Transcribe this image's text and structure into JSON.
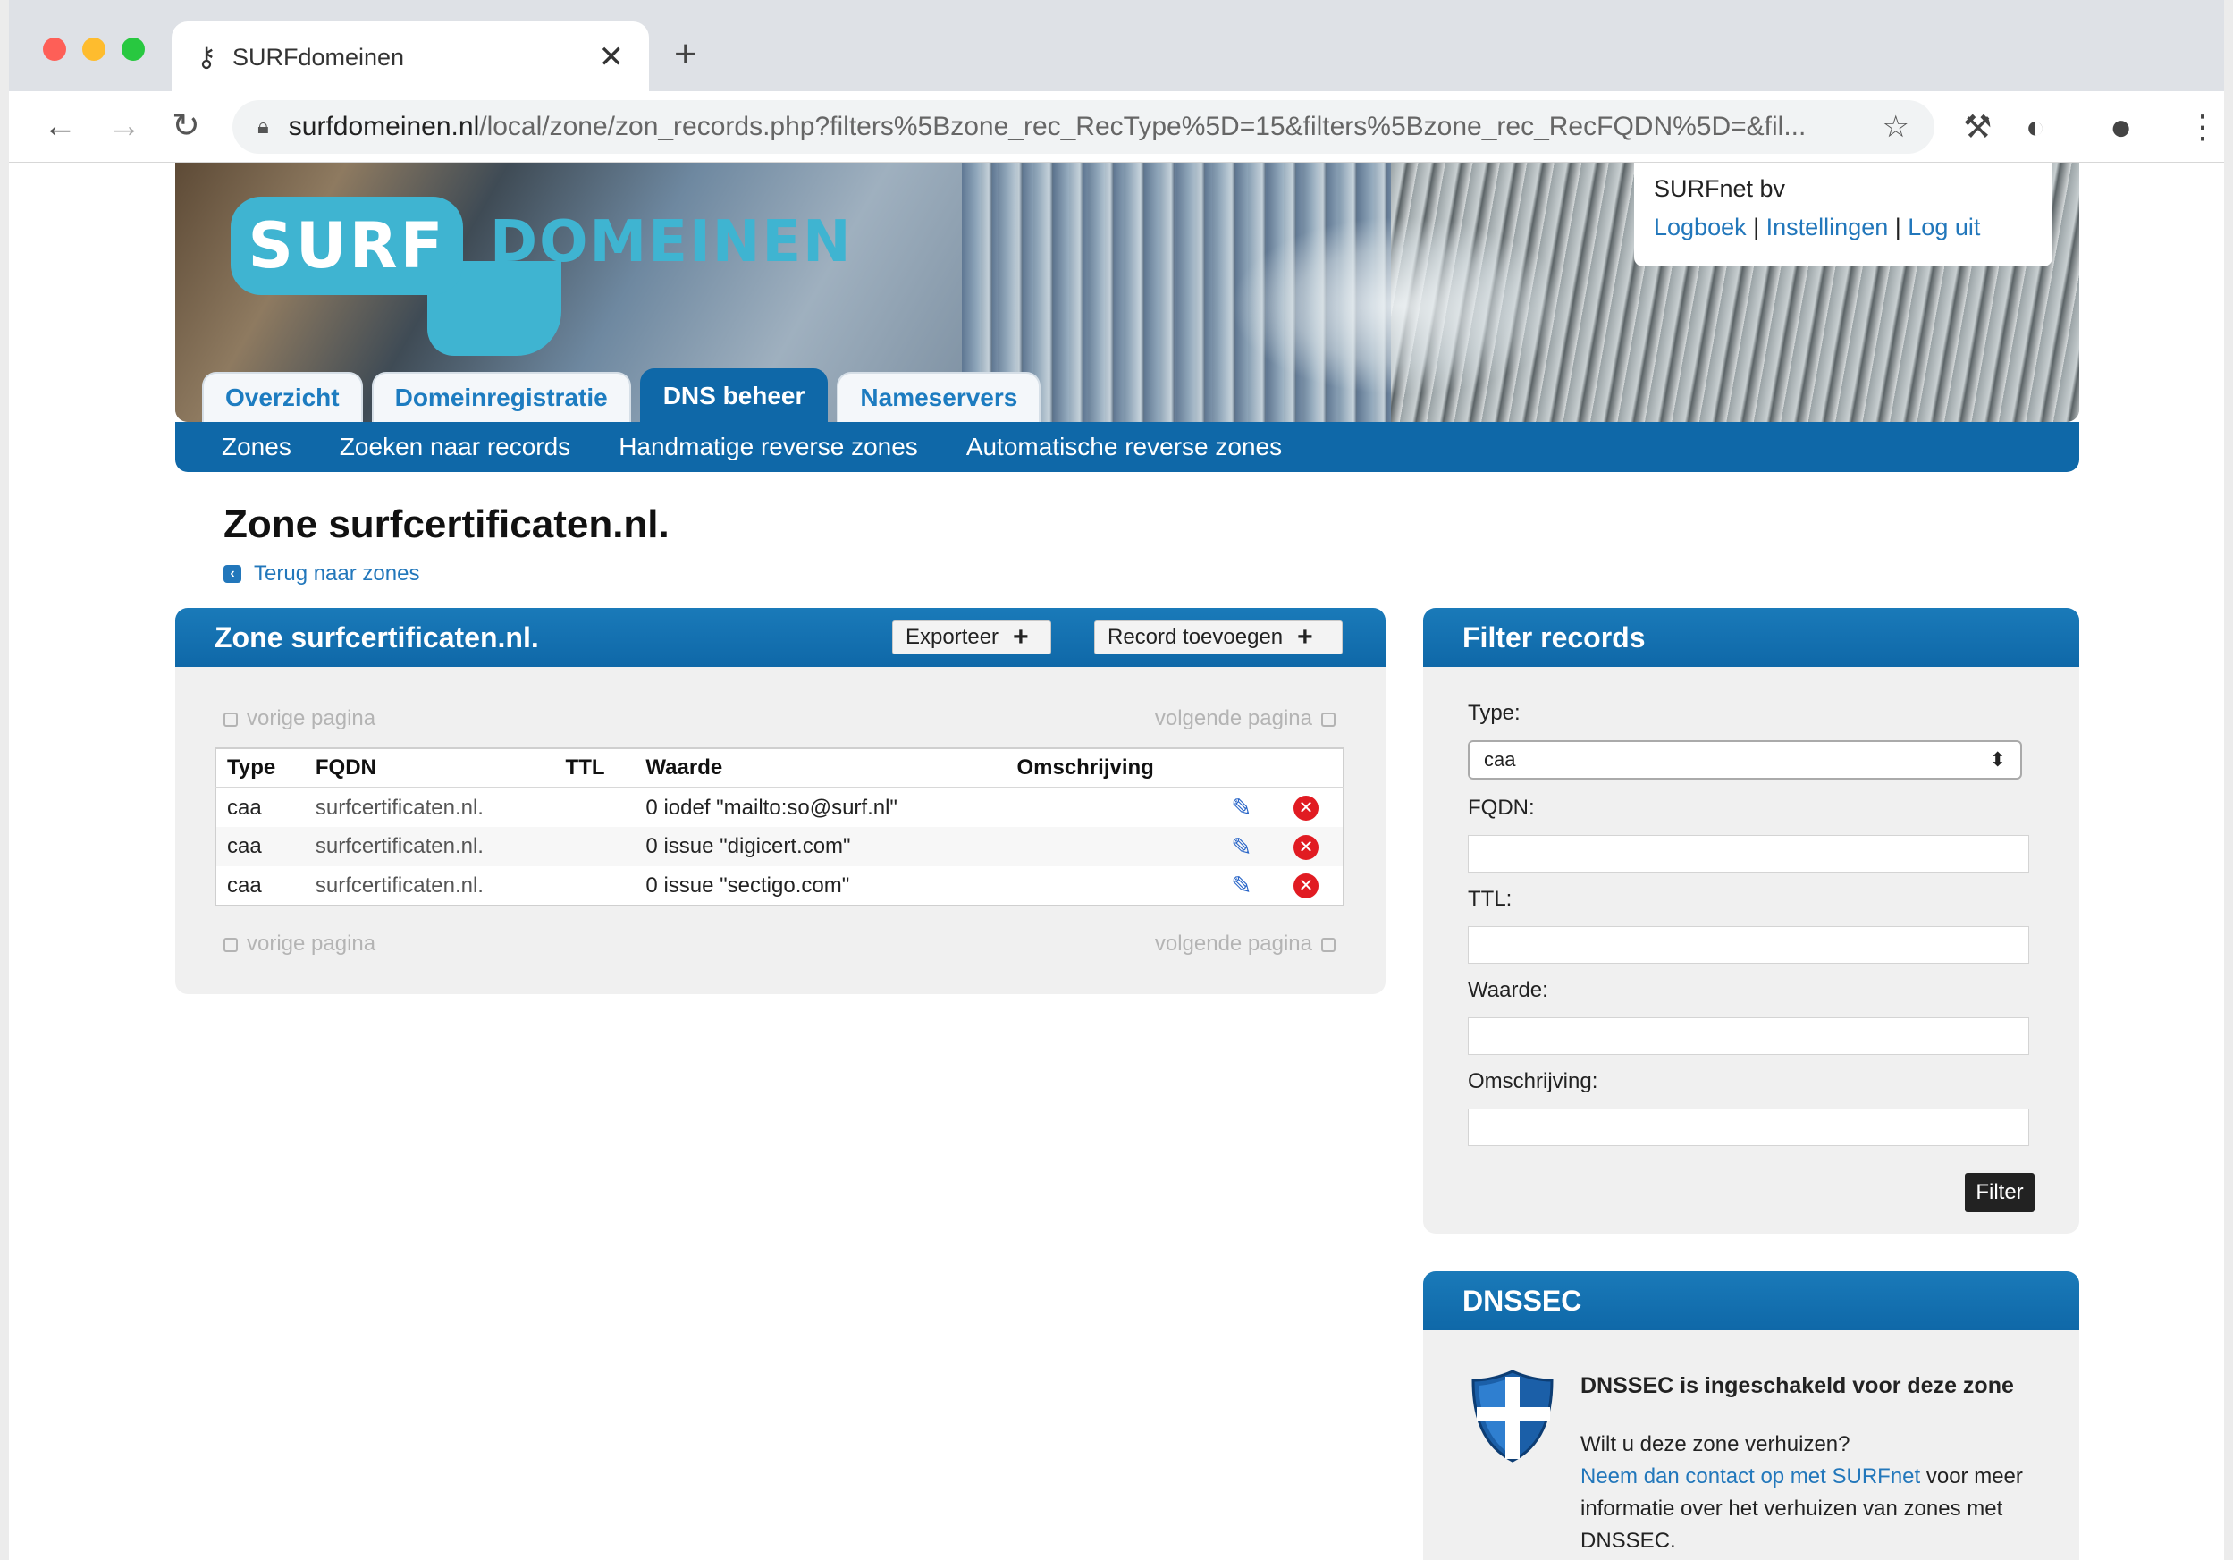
{
  "browser": {
    "tab_title": "SURFdomeinen",
    "url_host": "surfdomeinen.nl",
    "url_rest": "/local/zone/zon_records.php?filters%5Bzone_rec_RecType%5D=15&filters%5Bzone_rec_RecFQDN%5D=&fil..."
  },
  "header": {
    "logo_surf": "SURF",
    "logo_domeinen": "DOMEINEN",
    "account_name": "SURFnet bv",
    "links": {
      "logbook": "Logboek",
      "settings": "Instellingen",
      "logout": "Log uit",
      "separator": " | "
    }
  },
  "main_tabs": [
    {
      "label": "Overzicht",
      "active": false
    },
    {
      "label": "Domeinregistratie",
      "active": false
    },
    {
      "label": "DNS beheer",
      "active": true
    },
    {
      "label": "Nameservers",
      "active": false
    }
  ],
  "subnav": [
    "Zones",
    "Zoeken naar records",
    "Handmatige reverse zones",
    "Automatische reverse zones"
  ],
  "page": {
    "title": "Zone surfcertificaten.nl.",
    "back_link": "Terug naar zones"
  },
  "zone_panel": {
    "title": "Zone surfcertificaten.nl.",
    "export_label": "Exporteer",
    "add_label": "Record toevoegen",
    "prev_page": "vorige pagina",
    "next_page": "volgende pagina",
    "columns": [
      "Type",
      "FQDN",
      "TTL",
      "Waarde",
      "Omschrijving"
    ],
    "rows": [
      {
        "type": "caa",
        "fqdn": "surfcertificaten.nl.",
        "ttl": "",
        "value": "0 iodef \"mailto:so@surf.nl\"",
        "description": ""
      },
      {
        "type": "caa",
        "fqdn": "surfcertificaten.nl.",
        "ttl": "",
        "value": "0 issue \"digicert.com\"",
        "description": ""
      },
      {
        "type": "caa",
        "fqdn": "surfcertificaten.nl.",
        "ttl": "",
        "value": "0 issue \"sectigo.com\"",
        "description": ""
      }
    ]
  },
  "filter_panel": {
    "title": "Filter records",
    "type_label": "Type:",
    "type_value": "caa",
    "fqdn_label": "FQDN:",
    "ttl_label": "TTL:",
    "value_label": "Waarde:",
    "description_label": "Omschrijving:",
    "filter_button": "Filter"
  },
  "dnssec_panel": {
    "title": "DNSSEC",
    "status": "DNSSEC is ingeschakeld voor deze zone",
    "question": "Wilt u deze zone verhuizen?",
    "contact_link": "Neem dan contact op met SURFnet",
    "rest": " voor meer informatie over het verhuizen van zones met DNSSEC."
  },
  "colors": {
    "brand_blue": "#0f68a8",
    "logo_cyan": "#3fb4d1",
    "link_blue": "#2277bb",
    "delete_red": "#e11b22"
  }
}
